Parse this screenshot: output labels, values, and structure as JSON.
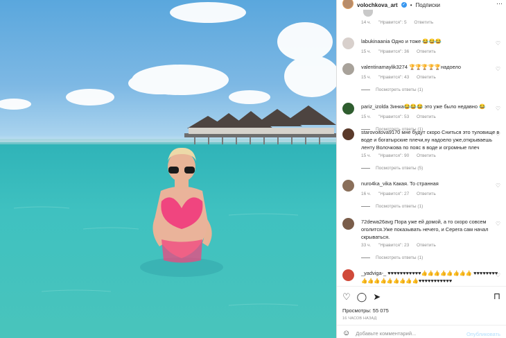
{
  "post": {
    "username": "volochkova_art",
    "follow_label": "Подписки",
    "more_icon": "more-dots-icon"
  },
  "first_meta": {
    "time": "14 ч.",
    "likes": "\"Нравится\": 5",
    "reply": "Ответить"
  },
  "comments": [
    {
      "user": "labukinaania",
      "text": "Одно и тоже 😂😂😂",
      "time": "15 ч.",
      "likes": "\"Нравится\": 36",
      "reply": "Ответить",
      "replies": "",
      "avatar_color": "#d8d0cc"
    },
    {
      "user": "valentinamaylik3274",
      "text": "🏆🏆🏆🏆🏆надоело",
      "time": "15 ч.",
      "likes": "\"Нравится\": 43",
      "reply": "Ответить",
      "replies": "Посмотреть ответы (1)",
      "avatar_color": "#a8a29a"
    },
    {
      "user": "pariz_izolda",
      "text": "Зинка😂😂😂 это уже было недавно 😂",
      "time": "15 ч.",
      "likes": "\"Нравится\": 53",
      "reply": "Ответить",
      "replies": "Посмотреть ответы (1)",
      "avatar_color": "#2f5d2f"
    },
    {
      "user": "starovoitova9170",
      "text": "мне будут скоро Сниться это туловище в воде и богатырские плечи,ну надоело уже,открываешь ленту Волочкова по пояс в воде и огромные плеч",
      "time": "15 ч.",
      "likes": "\"Нравится\": 90",
      "reply": "Ответить",
      "replies": "Посмотреть ответы (5)",
      "avatar_color": "#5a3a2a"
    },
    {
      "user": "nurо4ka_vika",
      "text": "Какая. То странная",
      "time": "16 ч.",
      "likes": "\"Нравится\": 27",
      "reply": "Ответить",
      "replies": "Посмотреть ответы (1)",
      "avatar_color": "#8a6f5a"
    },
    {
      "user": "72dewa26avg",
      "text": "Пора уже ей домой, а то скоро совсем оголится.Уже показывать нечего, и Серега сам начал скрываться.",
      "time": "33 ч.",
      "likes": "\"Нравится\": 23",
      "reply": "Ответить",
      "replies": "Посмотреть ответы (1)",
      "avatar_color": "#7a5d4a"
    },
    {
      "user": "_yadviga-_",
      "text": "♥♥♥♥♥♥♥♥♥♥♥👍👍👍👍👍👍👍👍 ♥♥♥♥♥♥♥♥👍👍👍👍👍👍👍👍👍♥♥♥♥♥♥♥♥♥♥♥",
      "time": "",
      "likes": "",
      "reply": "",
      "replies": "",
      "avatar_color": "#d04a3a"
    }
  ],
  "actions": {
    "like_icon": "heart-icon",
    "comment_icon": "comment-icon",
    "share_icon": "share-icon",
    "save_icon": "bookmark-icon"
  },
  "views": "Просмотры: 55 075",
  "ago": "16 ЧАСОВ НАЗАД",
  "add_comment": {
    "placeholder": "Добавьте комментарий...",
    "publish": "Опубликовать"
  }
}
